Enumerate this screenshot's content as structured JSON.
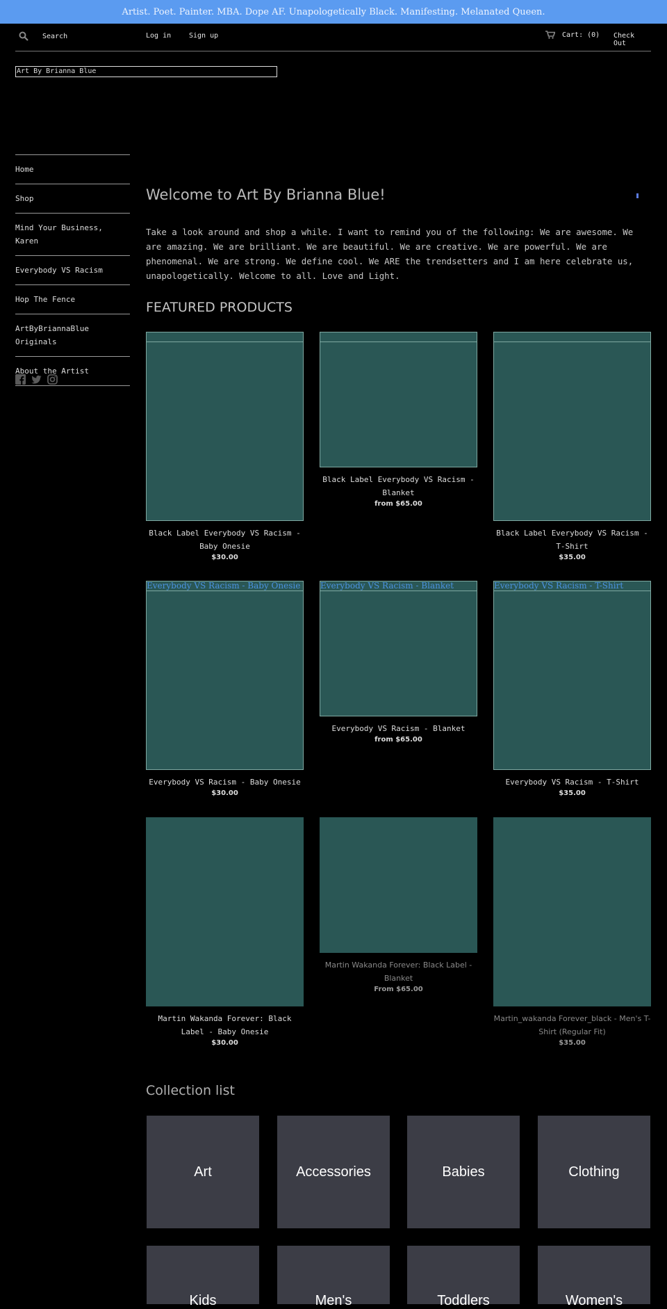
{
  "announcement": "Artist. Poet. Painter. MBA. Dope AF. Unapologetically Black. Manifesting. Melanated Queen.",
  "topbar": {
    "search_placeholder": "Search",
    "login": "Log in",
    "signup": "Sign up",
    "cart": "Cart: (0)",
    "checkout": "Check Out"
  },
  "logo_text": "Art By Brianna Blue",
  "sidebar": {
    "items": [
      {
        "label": "Home"
      },
      {
        "label": "Shop"
      },
      {
        "label": "Mind Your Business, Karen"
      },
      {
        "label": "Everybody VS Racism"
      },
      {
        "label": "Hop The Fence"
      },
      {
        "label": "ArtByBriannaBlue Originals"
      },
      {
        "label": "About the Artist"
      }
    ],
    "socials": [
      "facebook-icon",
      "twitter-icon",
      "instagram-icon"
    ]
  },
  "main": {
    "welcome_title": "Welcome to Art By Brianna Blue!",
    "intro": "Take a look around and shop a while. I want to remind you of the following: We are awesome. We are amazing. We are brilliant. We are beautiful. We are creative. We are powerful. We are phenomenal. We are strong. We define cool. We ARE the trendsetters and I am here celebrate us, unapologetically. Welcome to all. Love and Light.",
    "featured_title": "FEATURED PRODUCTS",
    "products": [
      {
        "title": "Black Label Everybody VS Racism - Baby Onesie",
        "price": "$30.00",
        "caption": ""
      },
      {
        "title": "Black Label Everybody VS Racism - Blanket",
        "price": "from $65.00",
        "caption": ""
      },
      {
        "title": "Black Label Everybody VS Racism - T-Shirt",
        "price": "$35.00",
        "caption": ""
      },
      {
        "title": "Everybody VS Racism - Baby Onesie",
        "price": "$30.00",
        "caption": "Everybody VS Racism - Baby Onesie"
      },
      {
        "title": "Everybody VS Racism - Blanket",
        "price": "from $65.00",
        "caption": "Everybody VS Racism - Blanket"
      },
      {
        "title": "Everybody VS Racism - T-Shirt",
        "price": "$35.00",
        "caption": "Everybody VS Racism - T-Shirt"
      },
      {
        "title": "Martin Wakanda Forever: Black Label - Baby Onesie",
        "price": "$30.00",
        "caption": ""
      },
      {
        "title": "Martin Wakanda Forever: Black Label - Blanket",
        "price": "From $65.00",
        "caption": ""
      },
      {
        "title": "Martin_wakanda Forever_black - Men's T-Shirt (Regular Fit)",
        "price": "$35.00",
        "caption": ""
      }
    ],
    "collection_title": "Collection list",
    "collections": [
      "Art",
      "Accessories",
      "Babies",
      "Clothing",
      "Kids",
      "Men's",
      "Toddlers",
      "Women's"
    ]
  }
}
